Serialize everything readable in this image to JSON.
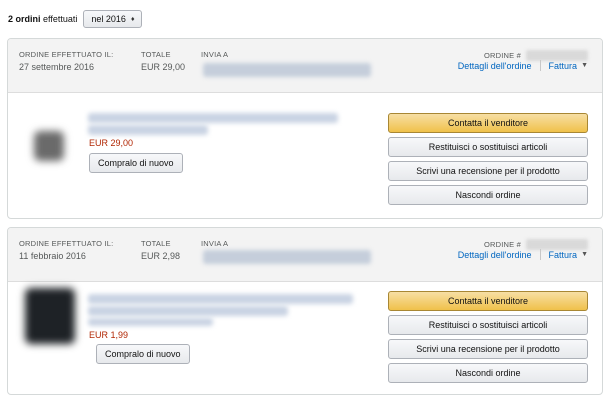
{
  "filter": {
    "count_bold": "2 ordini",
    "count_rest": "effettuati",
    "year_selected": "nel 2016"
  },
  "labels": {
    "placed": "ORDINE EFFETTUATO IL:",
    "total": "TOTALE",
    "ship_to": "INVIA A",
    "order_number": "ORDINE #",
    "details": "Dettagli dell'ordine",
    "invoice": "Fattura",
    "rebuy": "Compralo di nuovo",
    "contact_seller": "Contatta il venditore",
    "return_items": "Restituisci o sostituisci articoli",
    "write_review": "Scrivi una recensione per il prodotto",
    "hide_order": "Nascondi ordine"
  },
  "orders": [
    {
      "date": "27 settembre 2016",
      "total": "EUR 29,00",
      "item_price": "EUR 29,00"
    },
    {
      "date": "11 febbraio 2016",
      "total": "EUR 2,98",
      "item_price": "EUR 1,99"
    }
  ],
  "colors": {
    "link": "#0066c0",
    "price": "#b12704",
    "primary_button": "#f0c14b"
  }
}
